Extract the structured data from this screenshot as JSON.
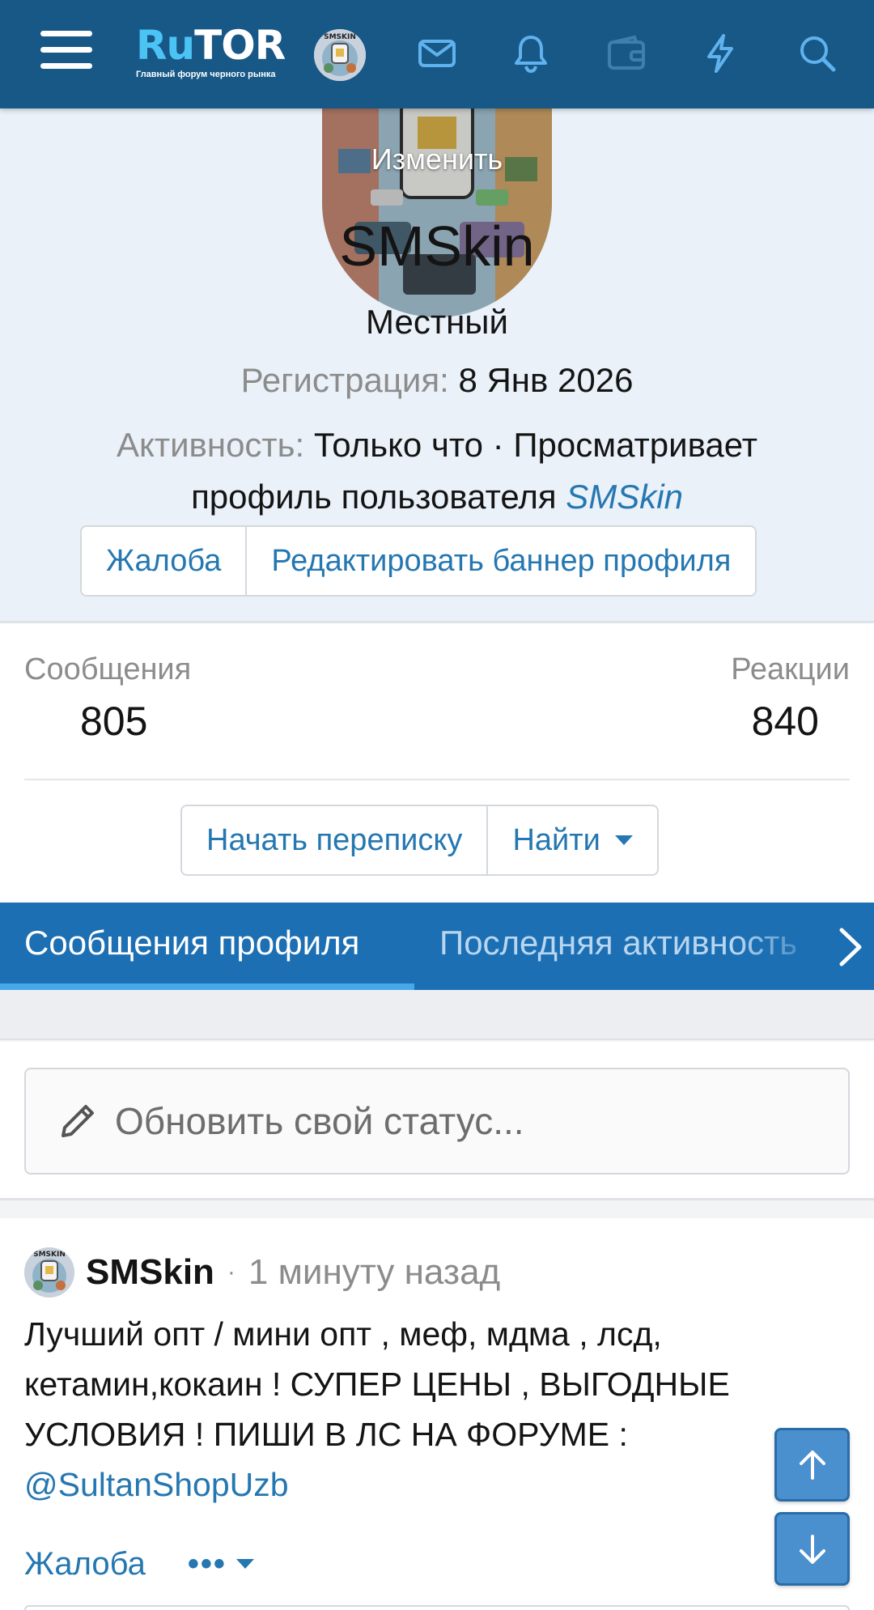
{
  "header": {
    "logo_ru": "Ru",
    "logo_tor": "TOR",
    "logo_subtitle": "Главный форум черного рынка",
    "icons": [
      "menu-icon",
      "mail-icon",
      "bell-icon",
      "wallet-icon",
      "lightning-icon",
      "search-icon"
    ],
    "avatar_caption": "SMSKIN"
  },
  "profile": {
    "change_avatar_label": "Изменить",
    "username": "SMSkin",
    "user_title": "Местный",
    "registration_label": "Регистрация:",
    "registration_value": "8 Янв 2026",
    "activity_label": "Активность:",
    "activity_value": "Только что",
    "activity_separator": "·",
    "activity_detail": "Просматривает профиль пользователя",
    "activity_link": "SMSkin",
    "report_button": "Жалоба",
    "edit_banner_button": "Редактировать баннер профиля"
  },
  "stats": {
    "messages_label": "Сообщения",
    "messages_value": "805",
    "reactions_label": "Реакции",
    "reactions_value": "840",
    "start_conversation_button": "Начать переписку",
    "find_button": "Найти"
  },
  "tabs": [
    {
      "label": "Сообщения профиля",
      "active": true
    },
    {
      "label": "Последняя активность",
      "active": false
    }
  ],
  "status": {
    "placeholder": "Обновить свой статус..."
  },
  "post": {
    "author": "SMSkin",
    "separator": "·",
    "time": "1 минуту назад",
    "avatar_caption": "SMSKIN",
    "body_text": "Лучший опт / мини опт , меф, мдма , лсд, кетамин,кокаин ! СУПЕР ЦЕНЫ , ВЫГОДНЫЕ УСЛОВИЯ ! ПИШИ В ЛС НА ФОРУМЕ :",
    "mention": "@SultanShopUzb",
    "report_link": "Жалоба",
    "more_label": "•••"
  },
  "colors": {
    "header_bg": "#185886",
    "tabs_bg": "#1c6fb3",
    "link": "#2577b1",
    "hero_bg": "#eaf1f9",
    "scroll_button": "#4a8fce"
  }
}
